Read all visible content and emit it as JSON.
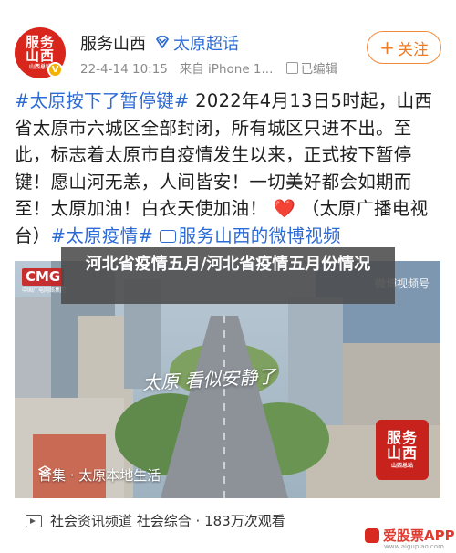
{
  "post": {
    "author": {
      "name": "服务山西",
      "badge_label": "太原超话",
      "avatar_line1": "服务",
      "avatar_line2": "山西",
      "avatar_sub": "山西总站"
    },
    "meta": {
      "date": "22-4-14 10:15",
      "source": "来自 iPhone 1...",
      "edited": "已编辑"
    },
    "follow_label": "关注",
    "text": {
      "hashtag1": "#太原按下了暂停键#",
      "body": " 2022年4月13日5时起，山西省太原市六城区全部封闭，所有城区只进不出。至此，标志着太原市自疫情发生以来，正式按下暂停键！愿山河无恙，人间皆安！一切美好都会如期而至！太原加油！白衣天使加油！",
      "heart": "❤️",
      "source_note": "（太原广播电视台）",
      "hashtag2": "#太原疫情#",
      "video_link": "服务山西的微博视频"
    },
    "video": {
      "logo": "CMG",
      "logo_sub": "中国广电网络集团",
      "watermark": "微博视频号",
      "handwriting": "太原 看似安静了",
      "stamp_line1": "服务",
      "stamp_line2": "山西",
      "stamp_sub": "山西总站",
      "collection": "合集 · 太原本地生活"
    },
    "footer": {
      "channel": "社会资讯频道 社会综合 · 183万次观看"
    }
  },
  "overlay": {
    "title": "河北省疫情五月/河北省疫情五月份情况"
  },
  "site_watermark": {
    "name": "爱股票APP",
    "url": "www.aigupiao.com"
  },
  "colors": {
    "link_blue": "#2c6ad6",
    "follow_orange": "#f07a22",
    "brand_red": "#d9261c"
  }
}
